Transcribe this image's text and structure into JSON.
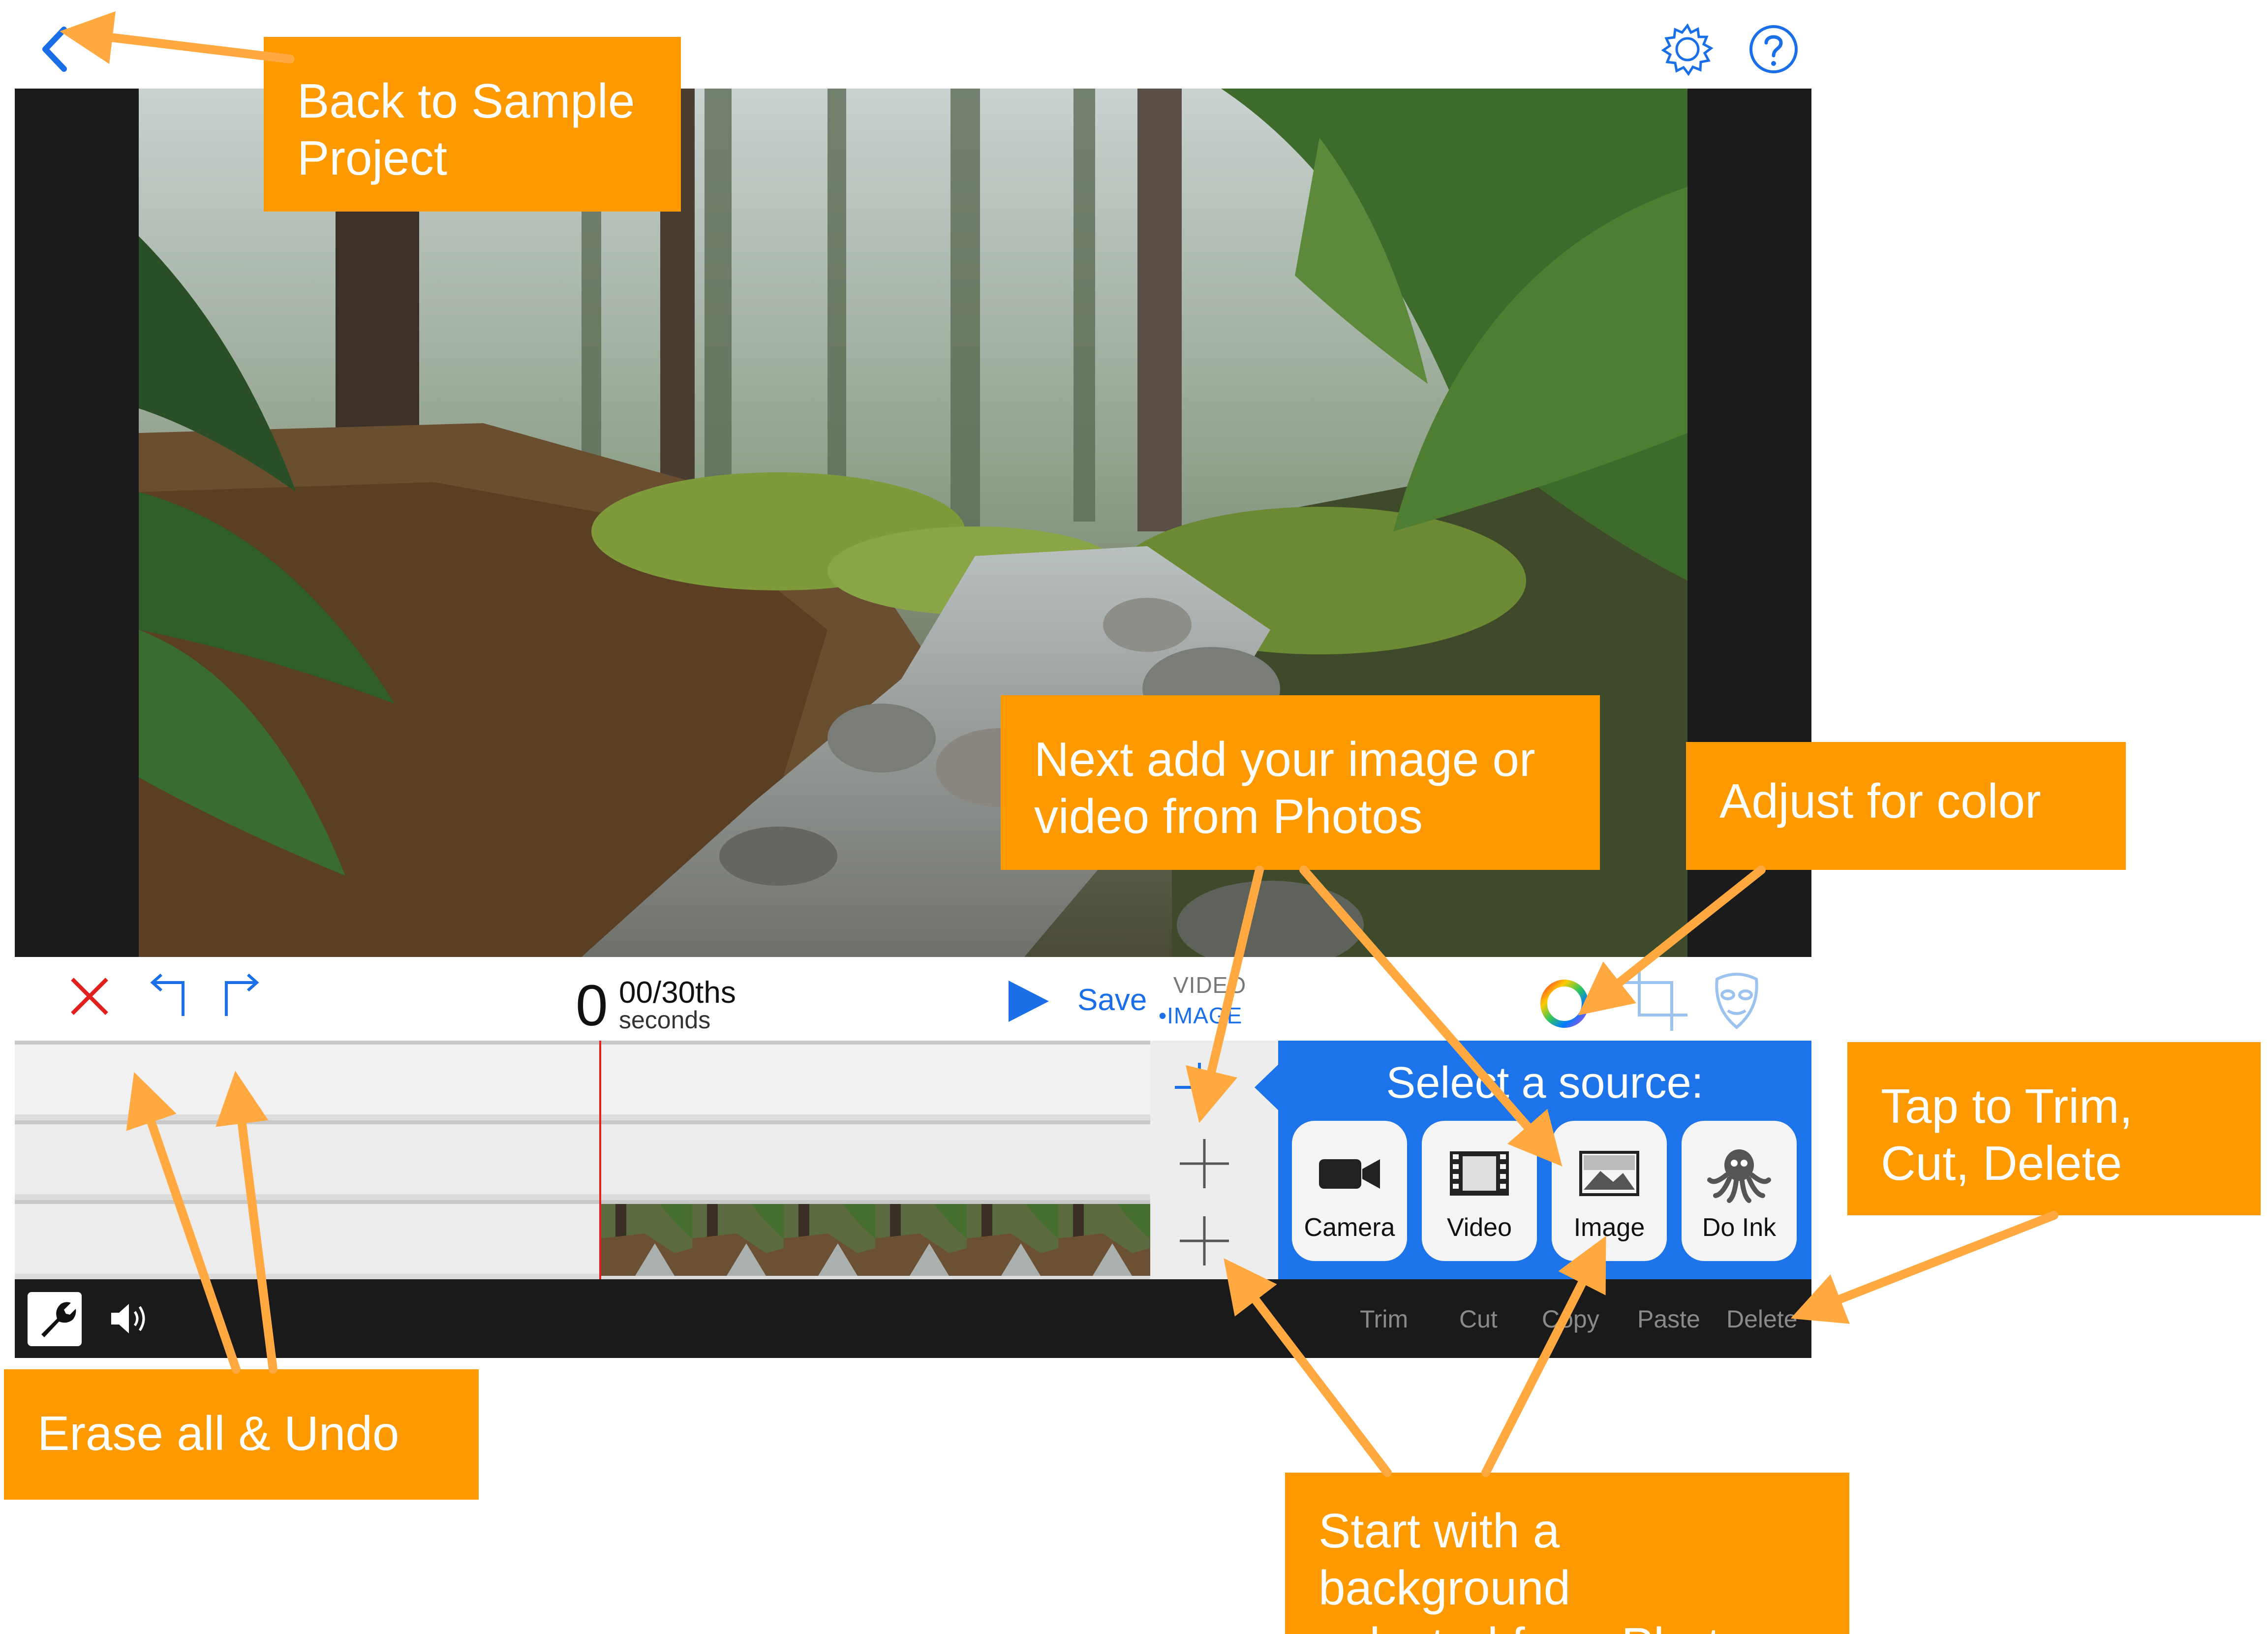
{
  "colors": {
    "accent": "#1a6fe8",
    "callout": "#ff9900",
    "erase_red": "#e0201c",
    "panel_blue": "#1d73ea"
  },
  "toolbar": {
    "time_value": "0",
    "time_fraction": "00/30ths",
    "time_unit": "seconds",
    "save_label": "Save",
    "mode_video": "VIDEO",
    "mode_image": "•IMAGE"
  },
  "source_panel": {
    "title": "Select a source:",
    "sources": [
      {
        "label": "Camera",
        "icon": "camera-icon"
      },
      {
        "label": "Video",
        "icon": "film-icon"
      },
      {
        "label": "Image",
        "icon": "image-icon"
      },
      {
        "label": "Do Ink",
        "icon": "octopus-icon"
      }
    ]
  },
  "edit_actions": [
    "Trim",
    "Cut",
    "Copy",
    "Paste",
    "Delete"
  ],
  "callouts": {
    "back": [
      "Back to Sample",
      "Project"
    ],
    "next_add": [
      "Next add your image or",
      "video  from Photos"
    ],
    "adjust_color": [
      "Adjust for color"
    ],
    "tap_trim": [
      "Tap to Trim,",
      "Cut, Delete"
    ],
    "erase_undo": [
      "Erase all  & Undo"
    ],
    "start_background": [
      "Start with a background",
      "selected from Photos"
    ]
  }
}
